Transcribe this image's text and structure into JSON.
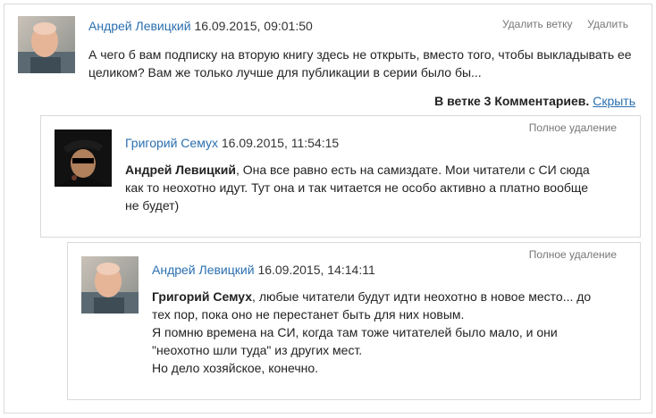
{
  "comments": [
    {
      "author": "Андрей Левицкий",
      "date": "16.09.2015, 09:01:50",
      "actions": [
        "Удалить ветку",
        "Удалить"
      ],
      "text": "А чего б вам подписку на вторую книгу здесь не открыть, вместо того, чтобы выкладывать ее целиком? Вам же только лучше для публикации в серии было бы..."
    },
    {
      "author": "Григорий Семух",
      "date": "16.09.2015, 11:54:15",
      "action": "Полное удаление",
      "mention": "Андрей Левицкий",
      "text": ", Она все равно есть на самиздате. Мои читатели с СИ сюда как то неохотно идут. Тут она и так читается не особо активно а платно вообще не будет)"
    },
    {
      "author": "Андрей Левицкий",
      "date": "16.09.2015, 14:14:11",
      "action": "Полное удаление",
      "mention": "Григорий Семух",
      "lines": [
        ", любые читатели будут идти неохотно в новое место... до тех пор, пока оно не перестанет быть для них новым.",
        "Я помню времена на СИ, когда там тоже читателей было мало, и они \"неохотно шли туда\" из других мест.",
        "Но дело хозяйское, конечно."
      ]
    }
  ],
  "thread": {
    "summary": "В ветке 3 Комментариев.",
    "hide_label": "Скрыть"
  }
}
